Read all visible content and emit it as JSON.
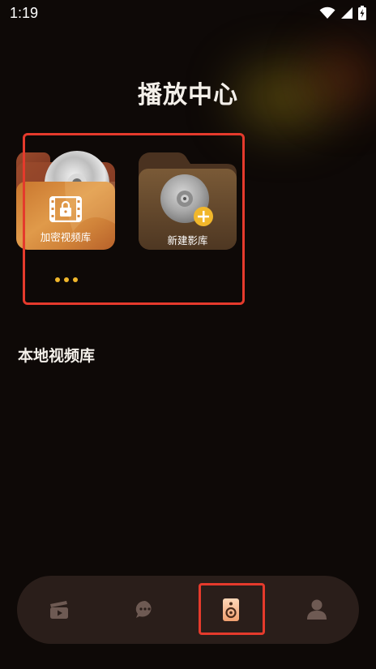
{
  "status_bar": {
    "time": "1:19",
    "icons": [
      "wifi-icon",
      "signal-icon",
      "battery-charging-icon"
    ]
  },
  "page": {
    "title": "播放中心",
    "section_title": "本地视频库"
  },
  "library_cards": [
    {
      "label": "加密视频库",
      "icon": "lock-film-icon"
    },
    {
      "label": "新建影库",
      "icon": "add-disc-icon"
    }
  ],
  "pager": {
    "dots": 3
  },
  "bottom_nav": {
    "items": [
      {
        "name": "video",
        "icon": "film-clapper-icon",
        "active": false
      },
      {
        "name": "messages",
        "icon": "chat-bubble-icon",
        "active": false
      },
      {
        "name": "player",
        "icon": "speaker-icon",
        "active": true
      },
      {
        "name": "profile",
        "icon": "user-icon",
        "active": false
      }
    ]
  },
  "colors": {
    "background": "#0e0907",
    "accent": "#f1b72b",
    "nav_bg": "#2a1e1a",
    "highlight": "#e53a2c"
  }
}
